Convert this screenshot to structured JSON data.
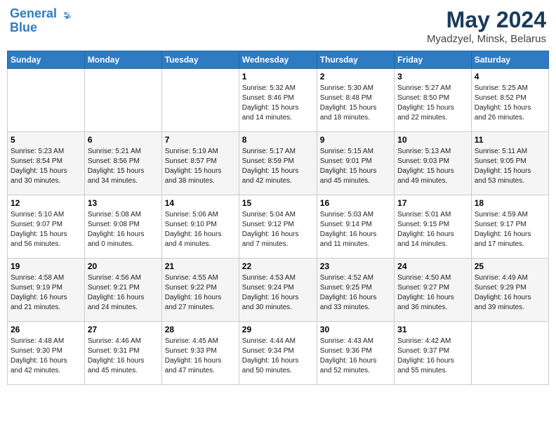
{
  "header": {
    "logo_line1": "General",
    "logo_line2": "Blue",
    "title": "May 2024",
    "subtitle": "Myadzyel, Minsk, Belarus"
  },
  "weekdays": [
    "Sunday",
    "Monday",
    "Tuesday",
    "Wednesday",
    "Thursday",
    "Friday",
    "Saturday"
  ],
  "weeks": [
    [
      {
        "day": "",
        "info": ""
      },
      {
        "day": "",
        "info": ""
      },
      {
        "day": "",
        "info": ""
      },
      {
        "day": "1",
        "info": "Sunrise: 5:32 AM\nSunset: 8:46 PM\nDaylight: 15 hours\nand 14 minutes."
      },
      {
        "day": "2",
        "info": "Sunrise: 5:30 AM\nSunset: 8:48 PM\nDaylight: 15 hours\nand 18 minutes."
      },
      {
        "day": "3",
        "info": "Sunrise: 5:27 AM\nSunset: 8:50 PM\nDaylight: 15 hours\nand 22 minutes."
      },
      {
        "day": "4",
        "info": "Sunrise: 5:25 AM\nSunset: 8:52 PM\nDaylight: 15 hours\nand 26 minutes."
      }
    ],
    [
      {
        "day": "5",
        "info": "Sunrise: 5:23 AM\nSunset: 8:54 PM\nDaylight: 15 hours\nand 30 minutes."
      },
      {
        "day": "6",
        "info": "Sunrise: 5:21 AM\nSunset: 8:56 PM\nDaylight: 15 hours\nand 34 minutes."
      },
      {
        "day": "7",
        "info": "Sunrise: 5:19 AM\nSunset: 8:57 PM\nDaylight: 15 hours\nand 38 minutes."
      },
      {
        "day": "8",
        "info": "Sunrise: 5:17 AM\nSunset: 8:59 PM\nDaylight: 15 hours\nand 42 minutes."
      },
      {
        "day": "9",
        "info": "Sunrise: 5:15 AM\nSunset: 9:01 PM\nDaylight: 15 hours\nand 45 minutes."
      },
      {
        "day": "10",
        "info": "Sunrise: 5:13 AM\nSunset: 9:03 PM\nDaylight: 15 hours\nand 49 minutes."
      },
      {
        "day": "11",
        "info": "Sunrise: 5:11 AM\nSunset: 9:05 PM\nDaylight: 15 hours\nand 53 minutes."
      }
    ],
    [
      {
        "day": "12",
        "info": "Sunrise: 5:10 AM\nSunset: 9:07 PM\nDaylight: 15 hours\nand 56 minutes."
      },
      {
        "day": "13",
        "info": "Sunrise: 5:08 AM\nSunset: 9:08 PM\nDaylight: 16 hours\nand 0 minutes."
      },
      {
        "day": "14",
        "info": "Sunrise: 5:06 AM\nSunset: 9:10 PM\nDaylight: 16 hours\nand 4 minutes."
      },
      {
        "day": "15",
        "info": "Sunrise: 5:04 AM\nSunset: 9:12 PM\nDaylight: 16 hours\nand 7 minutes."
      },
      {
        "day": "16",
        "info": "Sunrise: 5:03 AM\nSunset: 9:14 PM\nDaylight: 16 hours\nand 11 minutes."
      },
      {
        "day": "17",
        "info": "Sunrise: 5:01 AM\nSunset: 9:15 PM\nDaylight: 16 hours\nand 14 minutes."
      },
      {
        "day": "18",
        "info": "Sunrise: 4:59 AM\nSunset: 9:17 PM\nDaylight: 16 hours\nand 17 minutes."
      }
    ],
    [
      {
        "day": "19",
        "info": "Sunrise: 4:58 AM\nSunset: 9:19 PM\nDaylight: 16 hours\nand 21 minutes."
      },
      {
        "day": "20",
        "info": "Sunrise: 4:56 AM\nSunset: 9:21 PM\nDaylight: 16 hours\nand 24 minutes."
      },
      {
        "day": "21",
        "info": "Sunrise: 4:55 AM\nSunset: 9:22 PM\nDaylight: 16 hours\nand 27 minutes."
      },
      {
        "day": "22",
        "info": "Sunrise: 4:53 AM\nSunset: 9:24 PM\nDaylight: 16 hours\nand 30 minutes."
      },
      {
        "day": "23",
        "info": "Sunrise: 4:52 AM\nSunset: 9:25 PM\nDaylight: 16 hours\nand 33 minutes."
      },
      {
        "day": "24",
        "info": "Sunrise: 4:50 AM\nSunset: 9:27 PM\nDaylight: 16 hours\nand 36 minutes."
      },
      {
        "day": "25",
        "info": "Sunrise: 4:49 AM\nSunset: 9:29 PM\nDaylight: 16 hours\nand 39 minutes."
      }
    ],
    [
      {
        "day": "26",
        "info": "Sunrise: 4:48 AM\nSunset: 9:30 PM\nDaylight: 16 hours\nand 42 minutes."
      },
      {
        "day": "27",
        "info": "Sunrise: 4:46 AM\nSunset: 9:31 PM\nDaylight: 16 hours\nand 45 minutes."
      },
      {
        "day": "28",
        "info": "Sunrise: 4:45 AM\nSunset: 9:33 PM\nDaylight: 16 hours\nand 47 minutes."
      },
      {
        "day": "29",
        "info": "Sunrise: 4:44 AM\nSunset: 9:34 PM\nDaylight: 16 hours\nand 50 minutes."
      },
      {
        "day": "30",
        "info": "Sunrise: 4:43 AM\nSunset: 9:36 PM\nDaylight: 16 hours\nand 52 minutes."
      },
      {
        "day": "31",
        "info": "Sunrise: 4:42 AM\nSunset: 9:37 PM\nDaylight: 16 hours\nand 55 minutes."
      },
      {
        "day": "",
        "info": ""
      }
    ]
  ]
}
